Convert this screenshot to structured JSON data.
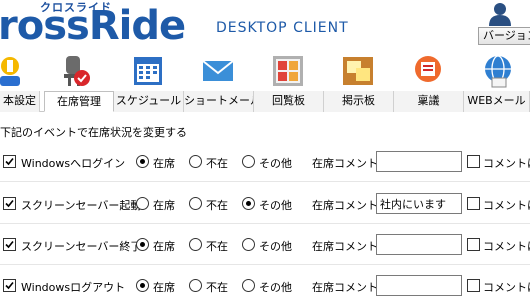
{
  "header": {
    "logo_kana": "クロスライド",
    "logo_main": "rossRide",
    "logo_sub": "DESKTOP CLIENT",
    "version_button": "バージョン"
  },
  "toolbar_icons": [
    "basic-settings-icon",
    "presence-icon",
    "schedule-icon",
    "short-mail-icon",
    "circulation-icon",
    "bulletin-board-icon",
    "approval-icon",
    "web-mail-icon"
  ],
  "tabs": [
    {
      "label": "本設定",
      "active": false
    },
    {
      "label": "在席管理",
      "active": true
    },
    {
      "label": "スケジュール",
      "active": false
    },
    {
      "label": "ショートメール",
      "active": false
    },
    {
      "label": "回覧板",
      "active": false
    },
    {
      "label": "掲示板",
      "active": false
    },
    {
      "label": "稟議",
      "active": false
    },
    {
      "label": "WEBメール",
      "active": false
    }
  ],
  "instruction": "下記のイベントで在席状況を変更する",
  "status_options": [
    "在席",
    "不在",
    "その他"
  ],
  "comment_label": "在席コメント",
  "comment_checkbox_label": "コメントは更",
  "rows": [
    {
      "event": "Windowsへログイン",
      "checked": true,
      "status": "在席",
      "comment": "",
      "comment_checked": false
    },
    {
      "event": "スクリーンセーバー起動",
      "checked": true,
      "status": "その他",
      "comment": "社内にいます",
      "comment_checked": false
    },
    {
      "event": "スクリーンセーバー終了",
      "checked": true,
      "status": "在席",
      "comment": "",
      "comment_checked": false
    },
    {
      "event": "Windowsログアウト",
      "checked": true,
      "status": "在席",
      "comment": "",
      "comment_checked": false
    }
  ],
  "colors": {
    "brand": "#1e5aa8"
  }
}
